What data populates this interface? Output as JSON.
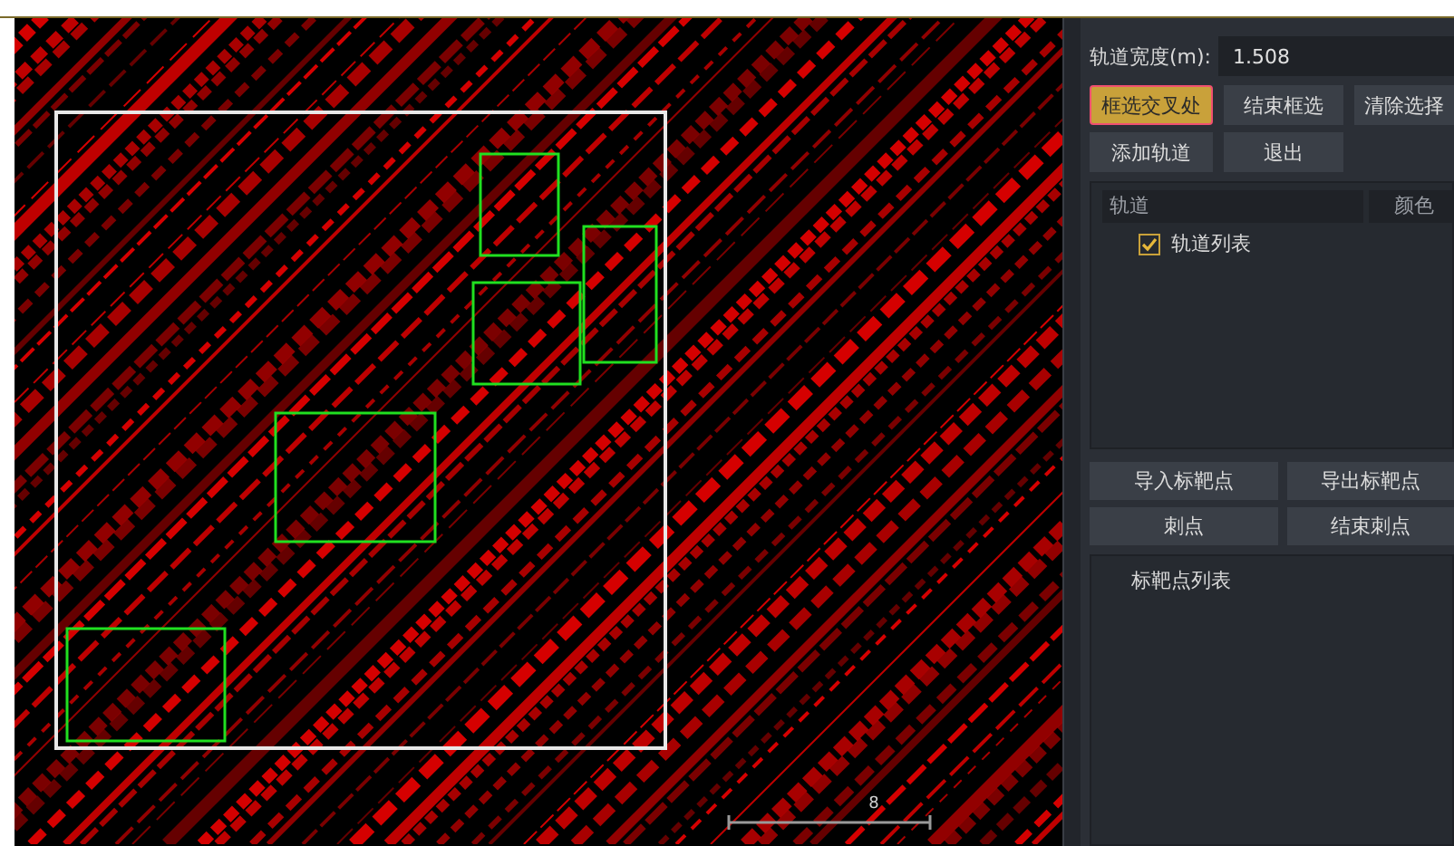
{
  "viewport": {
    "scale_label": "8"
  },
  "panel": {
    "track_width": {
      "label": "轨道宽度(m):",
      "value": "1.508"
    },
    "track_buttons": [
      {
        "label": "框选交叉处",
        "selected": true
      },
      {
        "label": "结束框选",
        "selected": false
      },
      {
        "label": "清除选择",
        "selected": false
      },
      {
        "label": "添加轨道",
        "selected": false
      },
      {
        "label": "退出",
        "selected": false
      }
    ],
    "track_table": {
      "columns": [
        "轨道",
        "颜色"
      ],
      "items": [
        {
          "label": "轨道列表",
          "checked": true
        }
      ]
    },
    "target_buttons": [
      "导入标靶点",
      "导出标靶点",
      "刺点",
      "结束刺点"
    ],
    "target_list": {
      "items": [
        "标靶点列表"
      ]
    }
  }
}
